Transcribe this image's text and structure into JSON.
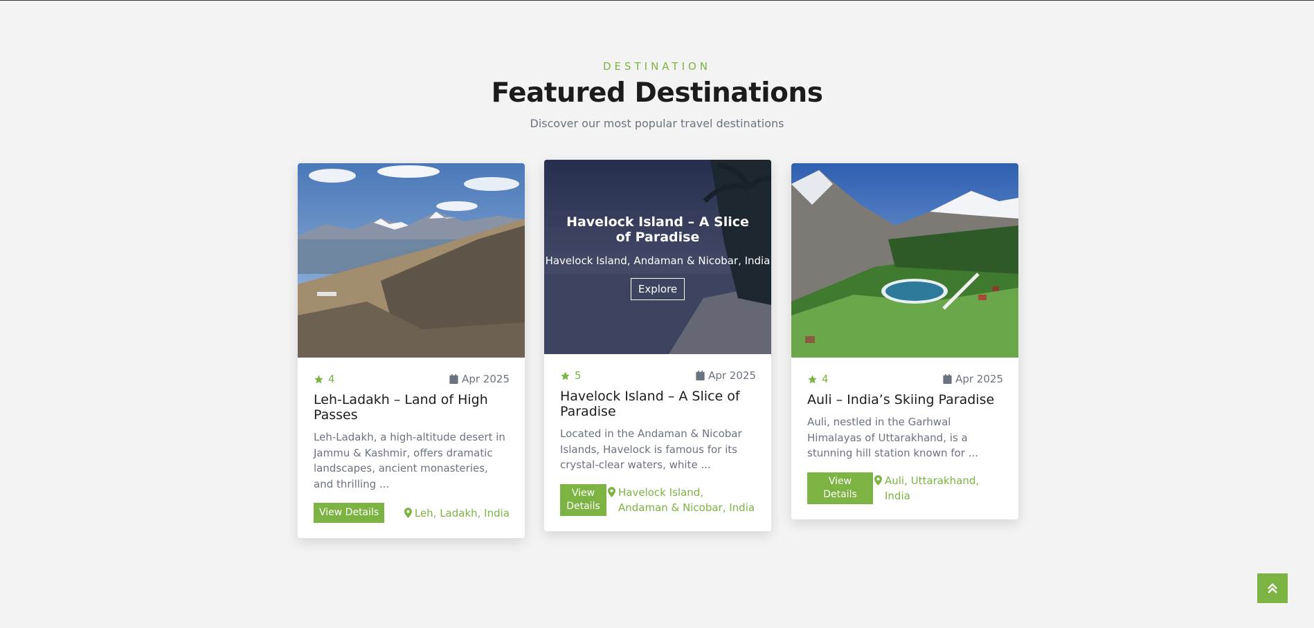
{
  "section": {
    "eyebrow": "DESTINATION",
    "title": "Featured Destinations",
    "subtitle": "Discover our most popular travel destinations"
  },
  "cards": [
    {
      "rating": "4",
      "date": "Apr 2025",
      "title": "Leh-Ladakh – Land of High Passes",
      "description": "Leh-Ladakh, a high-altitude desert in Jammu & Kashmir, offers dramatic landscapes, ancient monasteries, and thrilling ...",
      "button": "View Details",
      "location": "Leh, Ladakh, India"
    },
    {
      "rating": "5",
      "date": "Apr 2025",
      "title": "Havelock Island – A Slice of Paradise",
      "description": "Located in the Andaman & Nicobar Islands, Havelock is famous for its crystal-clear waters, white ...",
      "button": "View Details",
      "location": "Havelock Island, Andaman & Nicobar, India",
      "overlay": {
        "title": "Havelock Island – A Slice of Paradise",
        "location": "Havelock Island, Andaman & Nicobar, India",
        "button": "Explore"
      }
    },
    {
      "rating": "4",
      "date": "Apr 2025",
      "title": "Auli – India’s Skiing Paradise",
      "description": "Auli, nestled in the Garhwal Himalayas of Uttarakhand, is a stunning hill station known for ...",
      "button": "View Details",
      "location": "Auli, Uttarakhand, India"
    }
  ],
  "icons": {
    "rating": "star-icon",
    "date": "calendar-icon",
    "location": "map-pin-icon",
    "scroll_top": "double-chevron-up-icon"
  },
  "colors": {
    "accent": "#7cb342",
    "background": "#f3f3f3",
    "heading": "#1c1c1c",
    "text": "#6b7280"
  }
}
